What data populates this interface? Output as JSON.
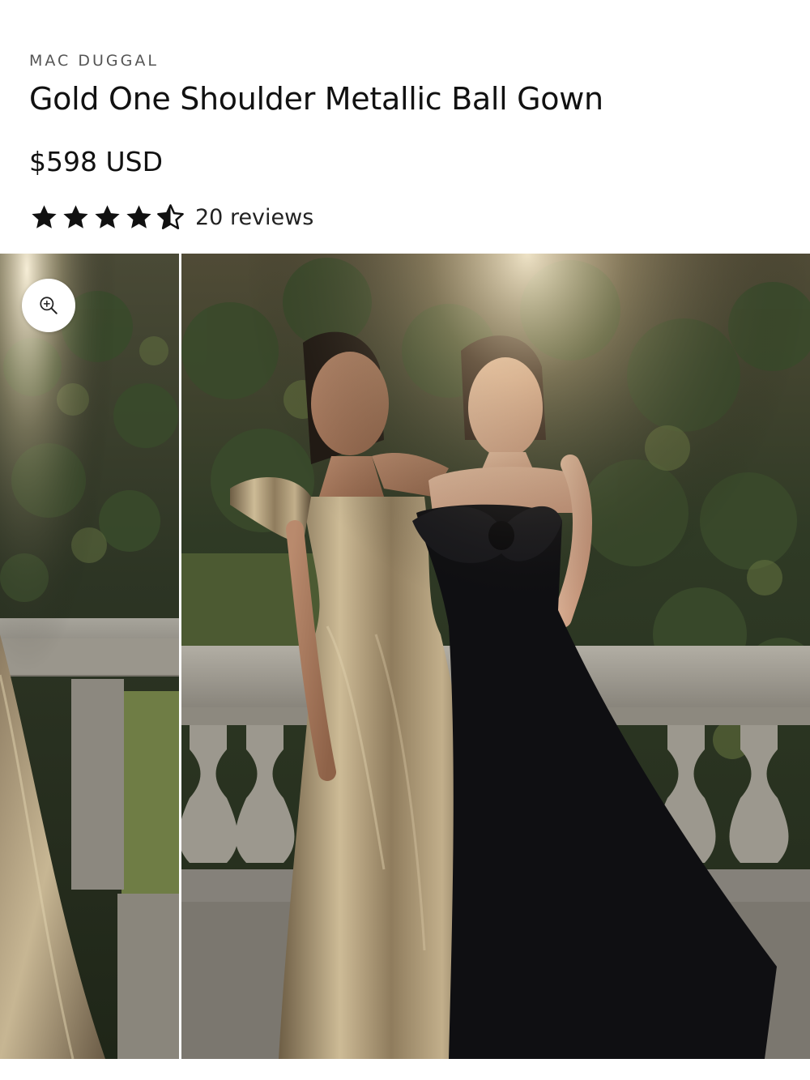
{
  "product": {
    "vendor": "MAC DUGGAL",
    "title": "Gold One Shoulder Metallic Ball Gown",
    "price": "$598 USD",
    "rating": {
      "value": 4.5,
      "max": 5,
      "reviews_label": "20 reviews"
    }
  },
  "gallery": {
    "zoom_icon": "zoom-in-icon",
    "images": [
      {
        "alt": "Gold metallic gown train on stone balustrade"
      },
      {
        "alt": "Two models in a gold one shoulder metallic ball gown and a black strapless bow gown"
      }
    ]
  },
  "colors": {
    "text": "#111111",
    "muted": "#555555",
    "star": "#111111"
  }
}
